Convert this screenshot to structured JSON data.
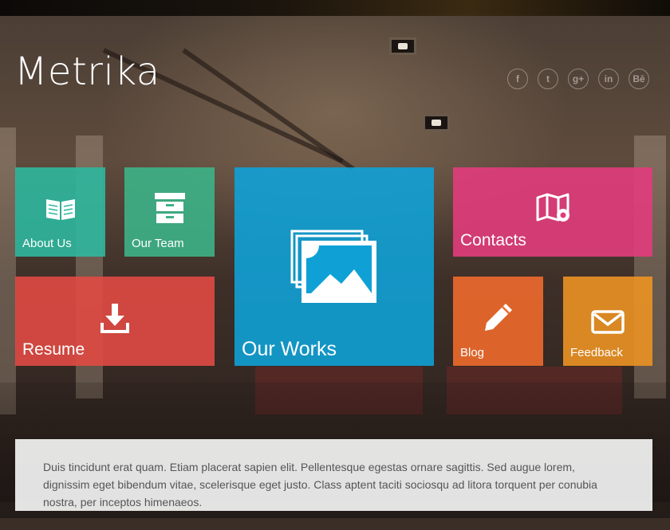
{
  "site": {
    "logo": "Metrika"
  },
  "social": [
    {
      "icon": "facebook-icon",
      "glyph": "f"
    },
    {
      "icon": "twitter-icon",
      "glyph": "t"
    },
    {
      "icon": "google-plus-icon",
      "glyph": "g+"
    },
    {
      "icon": "linkedin-icon",
      "glyph": "in"
    },
    {
      "icon": "behance-icon",
      "glyph": "Bē"
    }
  ],
  "tiles": {
    "about": {
      "label": "About Us",
      "color": "#2eb79d",
      "icon": "book-icon"
    },
    "team": {
      "label": "Our Team",
      "color": "#3db287",
      "icon": "cabinet-icon"
    },
    "works": {
      "label": "Our Works",
      "color": "#0fa1d6",
      "icon": "gallery-icon"
    },
    "contacts": {
      "label": "Contacts",
      "color": "#e13c7c",
      "icon": "map-icon"
    },
    "resume": {
      "label": "Resume",
      "color": "#e04a44",
      "icon": "download-icon"
    },
    "blog": {
      "label": "Blog",
      "color": "#ee6a2c",
      "icon": "pencil-icon"
    },
    "feedback": {
      "label": "Feedback",
      "color": "#eb9223",
      "icon": "envelope-icon"
    }
  },
  "content": {
    "text": "Duis tincidunt erat quam. Etiam placerat sapien elit. Pellentesque egestas ornare sagittis. Sed augue lorem, dignissim eget bibendum vitae, scelerisque eget justo. Class aptent taciti sociosqu ad litora torquent per conubia nostra, per inceptos himenaeos."
  }
}
